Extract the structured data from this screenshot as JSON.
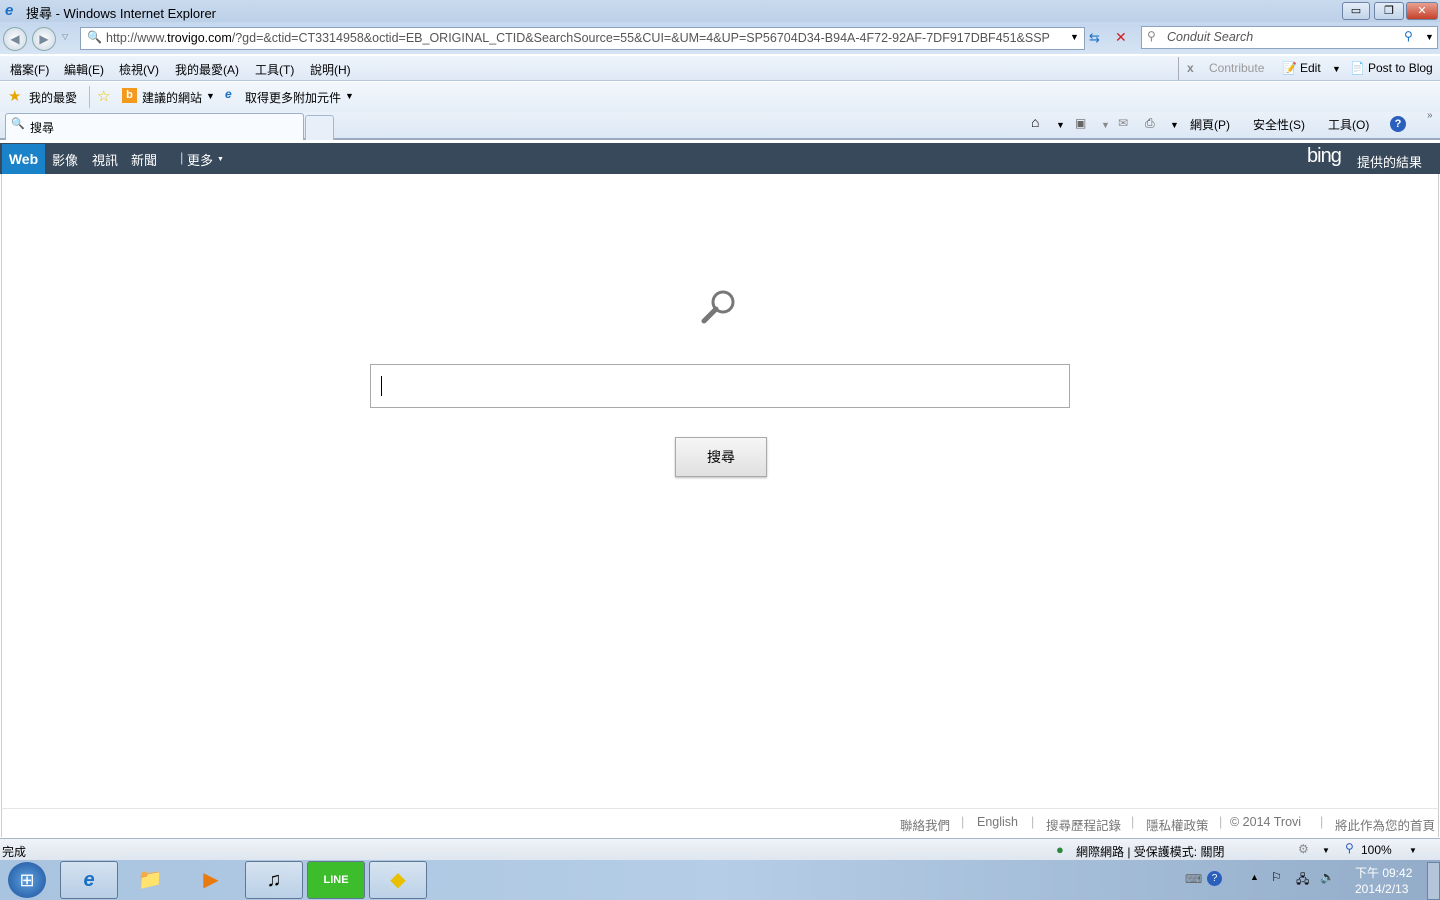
{
  "window": {
    "title": "搜尋 - Windows Internet Explorer",
    "minimize": "▭",
    "restore": "❐",
    "close": "✕"
  },
  "address": {
    "prefix": "http://www.",
    "domain": "trovigo.com",
    "rest": "/?gd=&ctid=CT3314958&octid=EB_ORIGINAL_CTID&SearchSource=55&CUI=&UM=4&UP=SP56704D34-B94A-4F72-92AF-7DF917DBF451&SSP"
  },
  "search_box": {
    "placeholder": "Conduit Search"
  },
  "menu": [
    "檔案(F)",
    "編輯(E)",
    "檢視(V)",
    "我的最愛(A)",
    "工具(T)",
    "說明(H)"
  ],
  "contribute": {
    "close": "x",
    "label": "Contribute",
    "edit": "Edit",
    "post": "Post to Blog"
  },
  "favorites": {
    "fav": "我的最愛",
    "suggested": "建議的網站",
    "addons": "取得更多附加元件"
  },
  "tab": {
    "title": "搜尋"
  },
  "commands": {
    "page": "網頁(P)",
    "safety": "安全性(S)",
    "tools": "工具(O)"
  },
  "bing_nav": {
    "items": [
      "Web",
      "影像",
      "視訊",
      "新聞"
    ],
    "more": "更多",
    "brand": "bing",
    "powered": "提供的結果"
  },
  "main": {
    "search_value": "",
    "search_button": "搜尋"
  },
  "footer": [
    "聯絡我們",
    "English",
    "搜尋歷程記錄",
    "隱私權政策",
    "© 2014 Trovi",
    "將此作為您的首頁"
  ],
  "status": {
    "text": "完成",
    "zone": "網際網路 | 受保護模式: 關閉",
    "zoom": "100%"
  },
  "taskbar": {
    "time": "下午 09:42",
    "date": "2014/2/13",
    "apps": [
      "Internet Explorer",
      "Explorer",
      "Media Player",
      "iTunes",
      "LINE",
      "App"
    ]
  }
}
